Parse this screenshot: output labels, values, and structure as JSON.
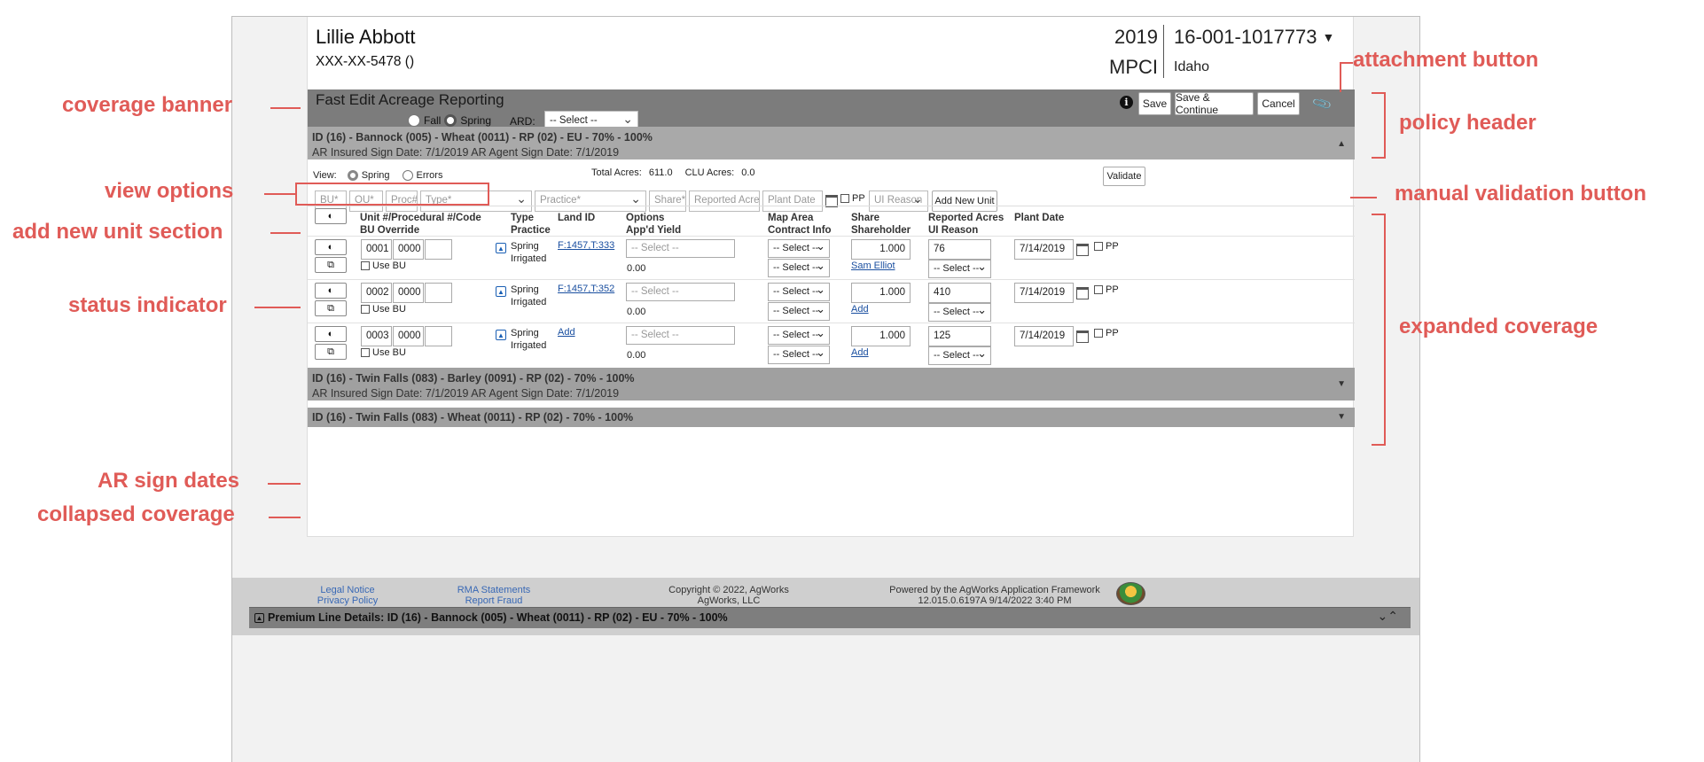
{
  "customer": {
    "name": "Lillie Abbott",
    "ssn": "XXX-XX-5478 ()"
  },
  "policy": {
    "year": "2019",
    "program": "MPCI",
    "number": "16-001-1017773",
    "state": "Idaho"
  },
  "banner": {
    "title": "Fast Edit Acreage Reporting",
    "season_fall": "Fall",
    "season_spring": "Spring",
    "selected_season": "Spring",
    "ard_label": "ARD:",
    "ard_value": "-- Select --",
    "save": "Save",
    "save_continue": "Save & Continue",
    "cancel": "Cancel"
  },
  "coverages": [
    {
      "title": "ID (16) - Bannock (005) - Wheat (0011) - RP (02) - EU - 70% - 100%",
      "dates": "AR Insured Sign Date: 7/1/2019   AR Agent Sign Date: 7/1/2019",
      "expanded": true
    },
    {
      "title": "ID (16) - Twin Falls (083) - Barley (0091) - RP (02) - 70% - 100%",
      "dates": "AR Insured Sign Date: 7/1/2019   AR Agent Sign Date: 7/1/2019",
      "expanded": false
    },
    {
      "title": "ID (16) - Twin Falls (083) - Wheat (0011) - RP (02) - 70% - 100%",
      "dates": "",
      "expanded": false
    }
  ],
  "view": {
    "label": "View:",
    "spring": "Spring",
    "errors": "Errors",
    "selected": "Spring"
  },
  "totals": {
    "total_label": "Total Acres:",
    "total_value": "611.0",
    "clu_label": "CLU Acres:",
    "clu_value": "0.0"
  },
  "validate": "Validate",
  "new_unit": {
    "bu": "BU*",
    "ou": "OU*",
    "proc": "Proc#",
    "type": "Type*",
    "practice": "Practice*",
    "share": "Share*",
    "reported": "Reported Acres",
    "plant_date": "Plant Date",
    "pp": "PP",
    "ui_reason": "UI Reason",
    "add_button": "Add New Unit"
  },
  "columns": {
    "unit": "Unit #/Procedural #/Code",
    "unit2": "BU Override",
    "type": "Type",
    "type2": "Practice",
    "land": "Land ID",
    "options": "Options",
    "options2": "App'd Yield",
    "map": "Map Area",
    "map2": "Contract Info",
    "share": "Share",
    "share2": "Shareholder",
    "reported": "Reported Acres",
    "reported2": "UI Reason",
    "plant": "Plant Date"
  },
  "rows": [
    {
      "unit": "0001",
      "proc": "0000",
      "code": "",
      "use_bu": "Use BU",
      "type": "Spring",
      "practice": "Irrigated",
      "land": "F:1457,T:333",
      "options": "-- Select --",
      "yield": "0.00",
      "map": "-- Select --",
      "contract": "-- Select --",
      "share": "1.000",
      "shareholder": "Sam Elliot",
      "acres": "76",
      "ui_reason": "-- Select --",
      "plant_date": "7/14/2019",
      "pp": "PP"
    },
    {
      "unit": "0002",
      "proc": "0000",
      "code": "",
      "use_bu": "Use BU",
      "type": "Spring",
      "practice": "Irrigated",
      "land": "F:1457,T:352",
      "options": "-- Select --",
      "yield": "0.00",
      "map": "-- Select --",
      "contract": "-- Select --",
      "share": "1.000",
      "shareholder": "Add",
      "acres": "410",
      "ui_reason": "-- Select --",
      "plant_date": "7/14/2019",
      "pp": "PP"
    },
    {
      "unit": "0003",
      "proc": "0000",
      "code": "",
      "use_bu": "Use BU",
      "type": "Spring",
      "practice": "Irrigated",
      "land": "Add",
      "options": "-- Select --",
      "yield": "0.00",
      "map": "-- Select --",
      "contract": "-- Select --",
      "share": "1.000",
      "shareholder": "Add",
      "acres": "125",
      "ui_reason": "-- Select --",
      "plant_date": "7/14/2019",
      "pp": "PP"
    }
  ],
  "footer": {
    "legal": "Legal Notice",
    "privacy": "Privacy Policy",
    "rma": "RMA Statements",
    "fraud": "Report Fraud",
    "copyright": "Copyright © 2022, AgWorks",
    "company": "AgWorks, LLC",
    "powered": "Powered by the AgWorks Application Framework",
    "version": "12.015.0.6197A 9/14/2022 3:40 PM"
  },
  "premium_bar": "Premium Line Details: ID (16) - Bannock (005) - Wheat (0011) - RP (02) - EU - 70% - 100%",
  "annotations": {
    "coverage_banner": "coverage banner",
    "view_options": "view options",
    "add_new_unit": "add new unit section",
    "status_indicator": "status indicator",
    "ar_sign_dates": "AR sign dates",
    "collapsed_coverage": "collapsed coverage",
    "attachment_button": "attachment button",
    "policy_header": "policy header",
    "manual_validation": "manual validation button",
    "expanded_coverage": "expanded coverage"
  },
  "colors": {
    "annotation": "#e05b57",
    "banner": "#7c7c7c",
    "coverage_header": "#a9a9a9",
    "link": "#1a4fa0"
  }
}
